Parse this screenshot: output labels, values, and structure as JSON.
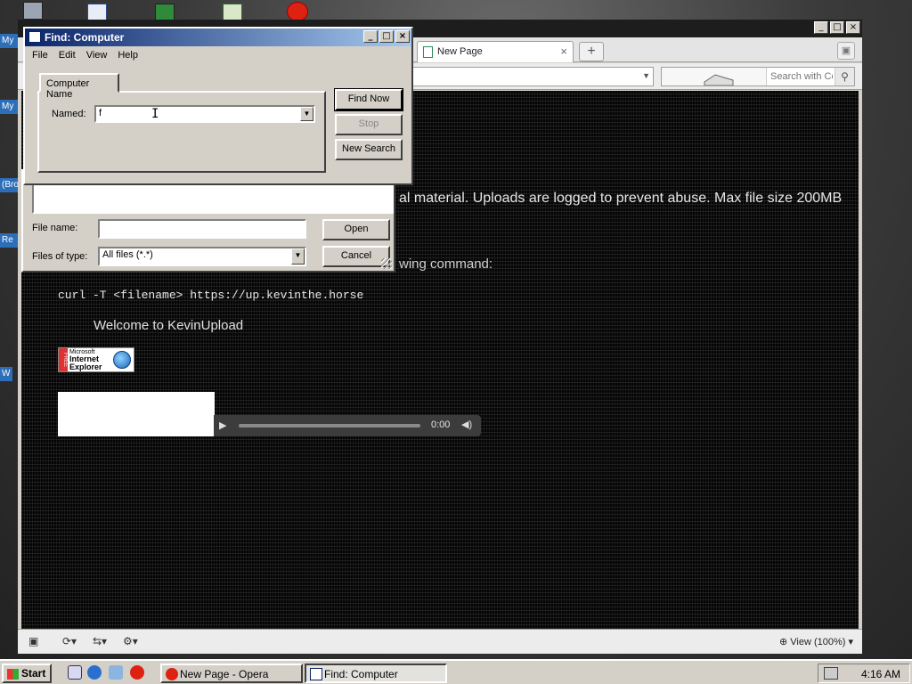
{
  "desktop": {
    "labels": [
      "My",
      "My",
      "(Bro",
      "Re",
      "W"
    ]
  },
  "opera": {
    "tab_title": "New Page",
    "tab_close": "×",
    "new_tab": "+",
    "search_placeholder": "Search with Co",
    "page": {
      "intro_text": "al material. Uploads are logged to prevent abuse. Max file size 200MB",
      "cmd_intro": "wing command:",
      "command": "curl -T <filename> https://up.kevinthe.horse",
      "welcome": "Welcome to KevinUpload",
      "ie_badge": {
        "line1": "Microsoft",
        "line2": "Internet",
        "line3": "Explorer",
        "free": "FREE"
      },
      "audio_time": "0:00"
    },
    "zoom_label": "View (100%)"
  },
  "file_dialog": {
    "file_name_label": "File name:",
    "file_name_value": "",
    "files_of_type_label": "Files of type:",
    "files_of_type_value": "All files (*.*)",
    "open_label": "Open",
    "cancel_label": "Cancel"
  },
  "find_dialog": {
    "title": "Find: Computer",
    "menu": [
      "File",
      "Edit",
      "View",
      "Help"
    ],
    "tab_label": "Computer Name",
    "named_label": "Named:",
    "named_value": "f",
    "find_now_label": "Find Now",
    "stop_label": "Stop",
    "new_search_label": "New Search"
  },
  "taskbar": {
    "start_label": "Start",
    "tasks": [
      {
        "label": "New Page - Opera",
        "active": false
      },
      {
        "label": "Find: Computer",
        "active": true
      }
    ],
    "clock": "4:16 AM"
  },
  "colors": {
    "title_active": "#0a246a",
    "window_face": "#d4d0c8",
    "page_bg": "#050505"
  }
}
